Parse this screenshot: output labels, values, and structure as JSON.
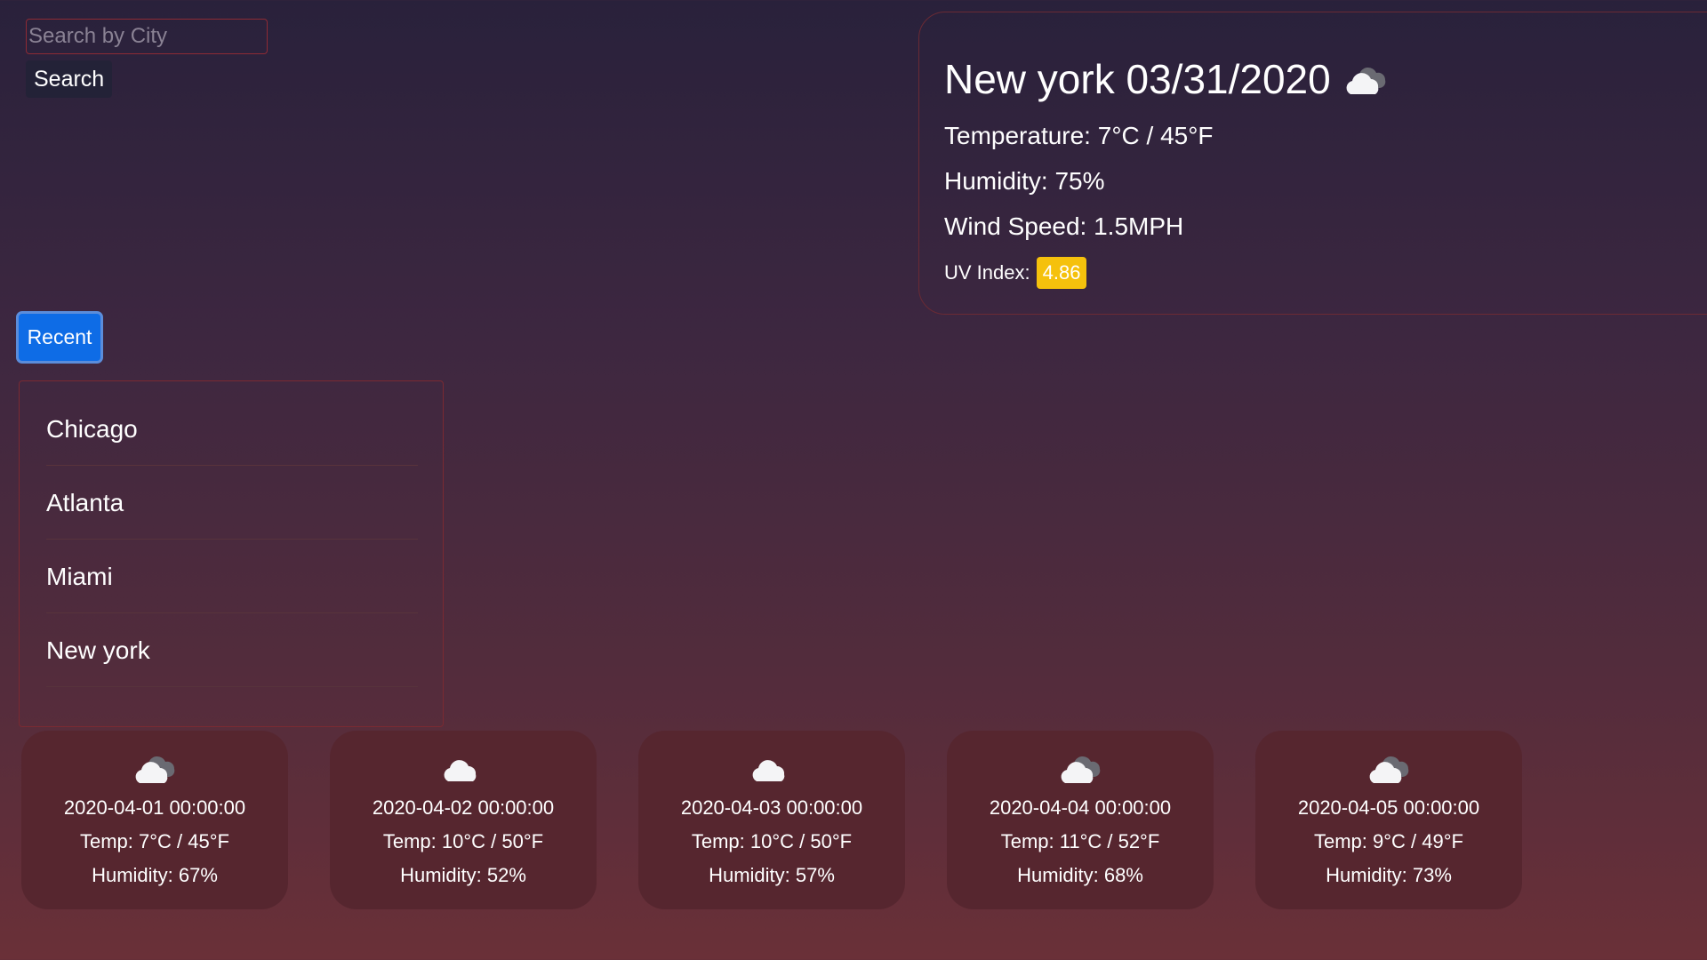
{
  "search": {
    "placeholder": "Search by City",
    "value": "",
    "button_label": "Search"
  },
  "current": {
    "city": "New york",
    "date": "03/31/2020",
    "icon": "broken-clouds-icon",
    "temperature": "Temperature: 7°C / 45°F",
    "humidity": "Humidity: 75%",
    "wind": "Wind Speed: 1.5MPH",
    "uv_label": "UV Index:",
    "uv_value": "4.86",
    "uv_color": "#f5c10c"
  },
  "recent": {
    "button_label": "Recent",
    "button_color": "#0e6ce6",
    "items": [
      "Chicago",
      "Atlanta",
      "Miami",
      "New york"
    ]
  },
  "forecast": [
    {
      "icon": "broken-clouds-icon",
      "date": "2020-04-01 00:00:00",
      "temp": "Temp: 7°C / 45°F",
      "humidity": "Humidity: 67%"
    },
    {
      "icon": "cloud-icon",
      "date": "2020-04-02 00:00:00",
      "temp": "Temp: 10°C / 50°F",
      "humidity": "Humidity: 52%"
    },
    {
      "icon": "cloud-icon",
      "date": "2020-04-03 00:00:00",
      "temp": "Temp: 10°C / 50°F",
      "humidity": "Humidity: 57%"
    },
    {
      "icon": "broken-clouds-icon",
      "date": "2020-04-04 00:00:00",
      "temp": "Temp: 11°C / 52°F",
      "humidity": "Humidity: 68%"
    },
    {
      "icon": "broken-clouds-icon",
      "date": "2020-04-05 00:00:00",
      "temp": "Temp: 9°C / 49°F",
      "humidity": "Humidity: 73%"
    }
  ]
}
